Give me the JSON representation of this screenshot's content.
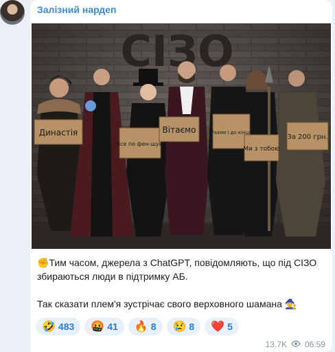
{
  "channel": {
    "name": "Залізний нардеп",
    "avatar_icon": "avatar"
  },
  "post_image": {
    "wall_text": "СІЗО",
    "signs": [
      "Династія",
      "Все по фен-шую",
      "Вітаємо",
      "Разом і до кінця",
      "Ми з тобою",
      "За 200 грн."
    ]
  },
  "message": {
    "line1": "✊Тим часом, джерела з ChatGPT, повідомляють, що під СІЗО збираються люди в підтримку АБ.",
    "line2": "Так сказати плем'я зустрічає свого верховного шамана 🧙"
  },
  "reactions": [
    {
      "emoji": "🤣",
      "count": "483"
    },
    {
      "emoji": "🤬",
      "count": "41"
    },
    {
      "emoji": "🔥",
      "count": "8"
    },
    {
      "emoji": "😢",
      "count": "8"
    },
    {
      "emoji": "❤️",
      "count": "5"
    }
  ],
  "meta": {
    "views": "13.7K",
    "time": "06:59"
  }
}
